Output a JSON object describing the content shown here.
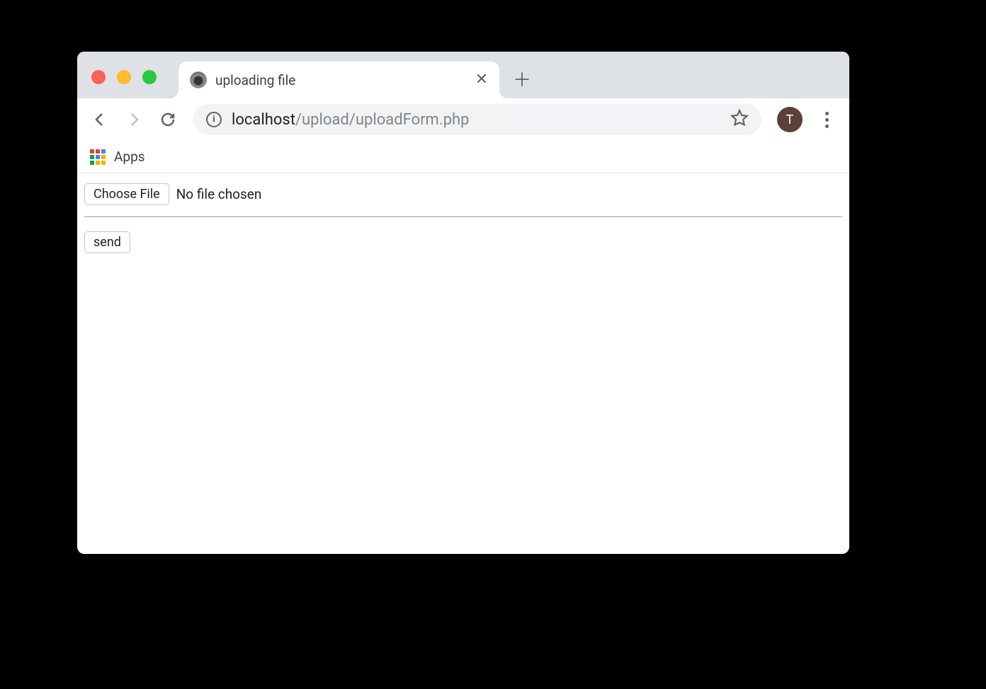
{
  "window": {
    "tab": {
      "title": "uploading file"
    },
    "url": {
      "host": "localhost",
      "path": "/upload/uploadForm.php"
    },
    "avatar_initial": "T",
    "bookmarks": {
      "apps_label": "Apps"
    }
  },
  "form": {
    "choose_file_label": "Choose File",
    "file_status": "No file chosen",
    "submit_label": "send"
  }
}
